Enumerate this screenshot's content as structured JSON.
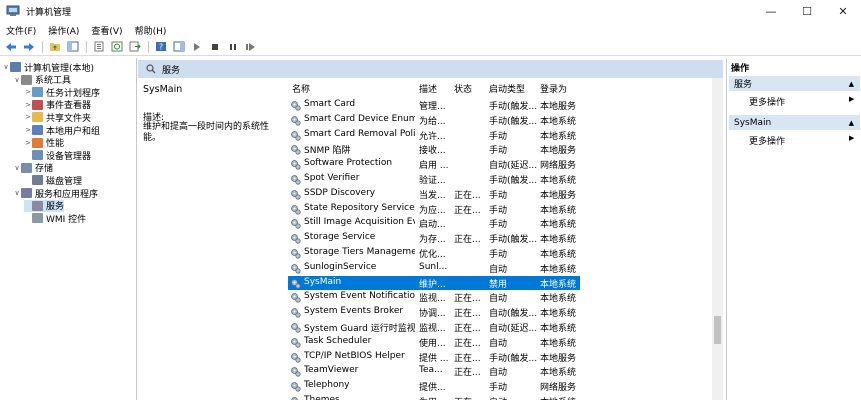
{
  "window": {
    "title": "计算机管理"
  },
  "menu": [
    "文件(F)",
    "操作(A)",
    "查看(V)",
    "帮助(H)"
  ],
  "tree": [
    {
      "label": "计算机管理(本地)",
      "name": "tree-root",
      "exp": "∨",
      "depth": 0,
      "icon": "#5a7fa8"
    },
    {
      "label": "系统工具",
      "name": "tree-system-tools",
      "exp": "∨",
      "depth": 1,
      "icon": "#8a8a8a"
    },
    {
      "label": "任务计划程序",
      "name": "tree-task-scheduler",
      "exp": ">",
      "depth": 2,
      "icon": "#6a9ac8"
    },
    {
      "label": "事件查看器",
      "name": "tree-event-viewer",
      "exp": ">",
      "depth": 2,
      "icon": "#c0504d"
    },
    {
      "label": "共享文件夹",
      "name": "tree-shared-folders",
      "exp": ">",
      "depth": 2,
      "icon": "#e8b84a"
    },
    {
      "label": "本地用户和组",
      "name": "tree-local-users",
      "exp": ">",
      "depth": 2,
      "icon": "#5b7fbf"
    },
    {
      "label": "性能",
      "name": "tree-performance",
      "exp": ">",
      "depth": 2,
      "icon": "#e07b39"
    },
    {
      "label": "设备管理器",
      "name": "tree-device-manager",
      "exp": "",
      "depth": 2,
      "icon": "#6b8fb5"
    },
    {
      "label": "存储",
      "name": "tree-storage",
      "exp": "∨",
      "depth": 1,
      "icon": "#7a8ea5"
    },
    {
      "label": "磁盘管理",
      "name": "tree-disk-management",
      "exp": "",
      "depth": 2,
      "icon": "#6f7f8f"
    },
    {
      "label": "服务和应用程序",
      "name": "tree-services-apps",
      "exp": "∨",
      "depth": 1,
      "icon": "#7b7b9f"
    },
    {
      "label": "服务",
      "name": "tree-services",
      "exp": "",
      "depth": 2,
      "icon": "#8a8aa0",
      "selected": true
    },
    {
      "label": "WMI 控件",
      "name": "tree-wmi",
      "exp": "",
      "depth": 2,
      "icon": "#8a9aa0"
    }
  ],
  "center": {
    "header": "服务",
    "selected_name": "SysMain",
    "desc_label": "描述:",
    "desc_text": "维护和提高一段时间内的系统性能。"
  },
  "columns": {
    "name": "名称",
    "desc": "描述",
    "state": "状态",
    "startup": "启动类型",
    "login": "登录为"
  },
  "services": [
    {
      "name": "Smart Card",
      "desc": "管理...",
      "state": "",
      "startup": "手动(触发...",
      "login": "本地服务"
    },
    {
      "name": "Smart Card Device Enumer...",
      "desc": "为给...",
      "state": "",
      "startup": "手动(触发...",
      "login": "本地系统"
    },
    {
      "name": "Smart Card Removal Policy",
      "desc": "允许...",
      "state": "",
      "startup": "手动",
      "login": "本地系统"
    },
    {
      "name": "SNMP 陷阱",
      "desc": "接收...",
      "state": "",
      "startup": "手动",
      "login": "本地服务"
    },
    {
      "name": "Software Protection",
      "desc": "启用 ...",
      "state": "",
      "startup": "自动(延迟...",
      "login": "网络服务"
    },
    {
      "name": "Spot Verifier",
      "desc": "验证...",
      "state": "",
      "startup": "手动(触发...",
      "login": "本地系统"
    },
    {
      "name": "SSDP Discovery",
      "desc": "当发...",
      "state": "正在...",
      "startup": "手动",
      "login": "本地服务"
    },
    {
      "name": "State Repository Service",
      "desc": "为应...",
      "state": "正在...",
      "startup": "手动",
      "login": "本地系统"
    },
    {
      "name": "Still Image Acquisition Eve...",
      "desc": "启动...",
      "state": "",
      "startup": "手动",
      "login": "本地系统"
    },
    {
      "name": "Storage Service",
      "desc": "为存...",
      "state": "正在...",
      "startup": "手动(触发...",
      "login": "本地系统"
    },
    {
      "name": "Storage Tiers Management",
      "desc": "优化...",
      "state": "",
      "startup": "手动",
      "login": "本地系统"
    },
    {
      "name": "SunloginService",
      "desc": "Sunl...",
      "state": "",
      "startup": "自动",
      "login": "本地系统"
    },
    {
      "name": "SysMain",
      "desc": "维护...",
      "state": "",
      "startup": "禁用",
      "login": "本地系统",
      "selected": true
    },
    {
      "name": "System Event Notification ...",
      "desc": "监视...",
      "state": "正在...",
      "startup": "自动",
      "login": "本地系统"
    },
    {
      "name": "System Events Broker",
      "desc": "协调...",
      "state": "正在...",
      "startup": "自动(触发...",
      "login": "本地系统"
    },
    {
      "name": "System Guard 运行时监视...",
      "desc": "监视...",
      "state": "正在...",
      "startup": "自动(延迟...",
      "login": "本地系统"
    },
    {
      "name": "Task Scheduler",
      "desc": "使用...",
      "state": "正在...",
      "startup": "自动",
      "login": "本地系统"
    },
    {
      "name": "TCP/IP NetBIOS Helper",
      "desc": "提供 ...",
      "state": "正在...",
      "startup": "手动(触发...",
      "login": "本地服务"
    },
    {
      "name": "TeamViewer",
      "desc": "Tea...",
      "state": "正在...",
      "startup": "自动",
      "login": "本地系统"
    },
    {
      "name": "Telephony",
      "desc": "提供...",
      "state": "",
      "startup": "手动",
      "login": "网络服务"
    },
    {
      "name": "Themes",
      "desc": "为用...",
      "state": "正在...",
      "startup": "自动",
      "login": "本地系统"
    }
  ],
  "actions": {
    "title": "操作",
    "section1": "服务",
    "section1_item": "更多操作",
    "section2": "SysMain",
    "section2_item": "更多操作"
  },
  "colors": {
    "selection": "#0078d7",
    "header_bg": "#cfdeee",
    "action_section_bg": "#d8e6f4"
  }
}
